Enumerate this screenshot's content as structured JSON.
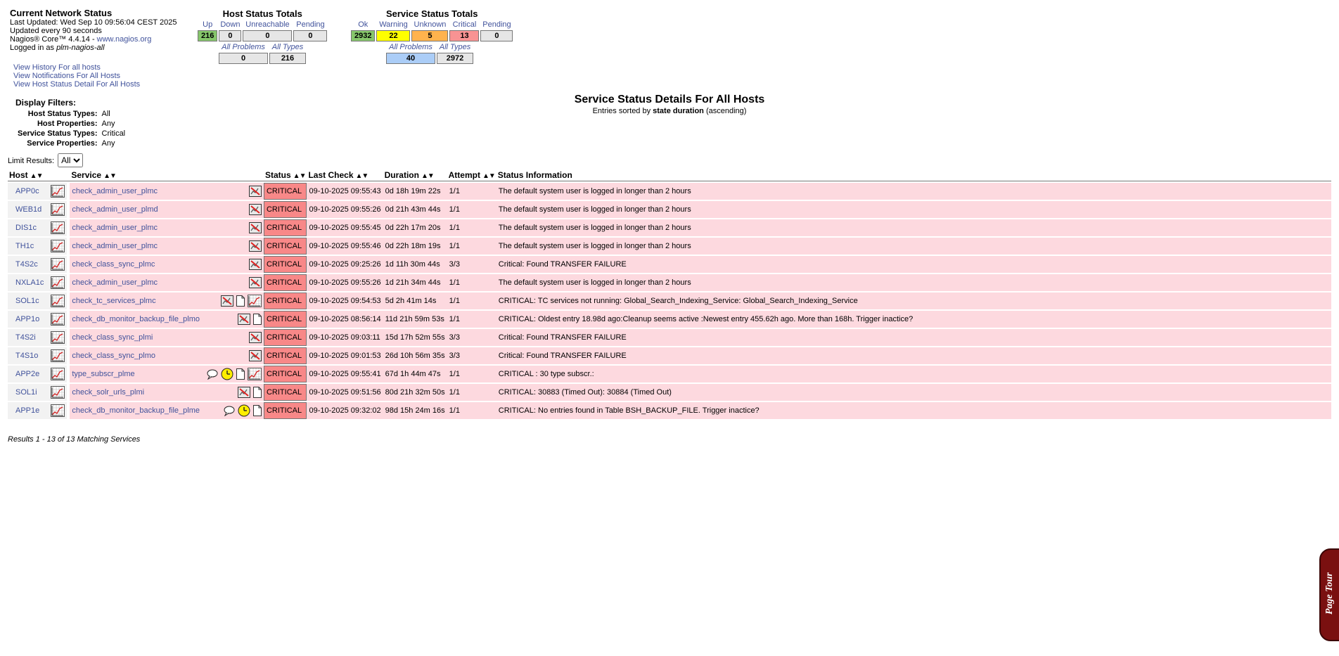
{
  "info": {
    "title": "Current Network Status",
    "last_updated": "Last Updated: Wed Sep 10 09:56:04 CEST 2025",
    "update_interval": "Updated every 90 seconds",
    "core_prefix": "Nagios® Core™ 4.4.14 - ",
    "core_link": "www.nagios.org",
    "logged_prefix": "Logged in as ",
    "logged_user": "plm-nagios-all"
  },
  "links": [
    "View History For all hosts",
    "View Notifications For All Hosts",
    "View Host Status Detail For All Hosts"
  ],
  "host_totals": {
    "title": "Host Status Totals",
    "headers": [
      "Up",
      "Down",
      "Unreachable",
      "Pending"
    ],
    "values": [
      "216",
      "0",
      "0",
      "0"
    ],
    "sub_headers": [
      "All Problems",
      "All Types"
    ],
    "sub_values": [
      "0",
      "216"
    ]
  },
  "service_totals": {
    "title": "Service Status Totals",
    "headers": [
      "Ok",
      "Warning",
      "Unknown",
      "Critical",
      "Pending"
    ],
    "values": [
      "2932",
      "22",
      "5",
      "13",
      "0"
    ],
    "sub_headers": [
      "All Problems",
      "All Types"
    ],
    "sub_values": [
      "40",
      "2972"
    ]
  },
  "page_title": {
    "title": "Service Status Details For All Hosts",
    "sort_prefix": "Entries sorted by ",
    "sort_field": "state duration",
    "sort_order": " (ascending)"
  },
  "filters": {
    "heading": "Display Filters:",
    "rows": [
      {
        "key": "Host Status Types:",
        "value": "All"
      },
      {
        "key": "Host Properties:",
        "value": "Any"
      },
      {
        "key": "Service Status Types:",
        "value": "Critical"
      },
      {
        "key": "Service Properties:",
        "value": "Any"
      }
    ]
  },
  "limit": {
    "label": "Limit Results:",
    "value": "All"
  },
  "table": {
    "headers": [
      "Host",
      "Service",
      "Status",
      "Last Check",
      "Duration",
      "Attempt",
      "Status Information"
    ],
    "rows": [
      {
        "host": "APP0c",
        "service": "check_admin_user_plmc",
        "icons": [
          "notif-disabled"
        ],
        "status": "CRITICAL",
        "last_check": "09-10-2025 09:55:43",
        "duration": "0d 18h 19m 22s",
        "attempt": "1/1",
        "info": "The default system user is logged in longer than 2 hours"
      },
      {
        "host": "WEB1d",
        "service": "check_admin_user_plmd",
        "icons": [
          "notif-disabled"
        ],
        "status": "CRITICAL",
        "last_check": "09-10-2025 09:55:26",
        "duration": "0d 21h 43m 44s",
        "attempt": "1/1",
        "info": "The default system user is logged in longer than 2 hours"
      },
      {
        "host": "DIS1c",
        "service": "check_admin_user_plmc",
        "icons": [
          "notif-disabled"
        ],
        "status": "CRITICAL",
        "last_check": "09-10-2025 09:55:45",
        "duration": "0d 22h 17m 20s",
        "attempt": "1/1",
        "info": "The default system user is logged in longer than 2 hours"
      },
      {
        "host": "TH1c",
        "service": "check_admin_user_plmc",
        "icons": [
          "notif-disabled"
        ],
        "status": "CRITICAL",
        "last_check": "09-10-2025 09:55:46",
        "duration": "0d 22h 18m 19s",
        "attempt": "1/1",
        "info": "The default system user is logged in longer than 2 hours"
      },
      {
        "host": "T4S2c",
        "service": "check_class_sync_plmc",
        "icons": [
          "notif-disabled"
        ],
        "status": "CRITICAL",
        "last_check": "09-10-2025 09:25:26",
        "duration": "1d 11h 30m 44s",
        "attempt": "3/3",
        "info": "Critical: Found TRANSFER FAILURE"
      },
      {
        "host": "NXLA1c",
        "service": "check_admin_user_plmc",
        "icons": [
          "notif-disabled"
        ],
        "status": "CRITICAL",
        "last_check": "09-10-2025 09:55:26",
        "duration": "1d 21h 34m 44s",
        "attempt": "1/1",
        "info": "The default system user is logged in longer than 2 hours"
      },
      {
        "host": "SOL1c",
        "service": "check_tc_services_plmc",
        "icons": [
          "notif-disabled",
          "doc",
          "graph"
        ],
        "status": "CRITICAL",
        "last_check": "09-10-2025 09:54:53",
        "duration": "5d 2h 41m 14s",
        "attempt": "1/1",
        "info": "CRITICAL: TC services not running: Global_Search_Indexing_Service: Global_Search_Indexing_Service"
      },
      {
        "host": "APP1o",
        "service": "check_db_monitor_backup_file_plmo",
        "icons": [
          "notif-disabled",
          "doc"
        ],
        "status": "CRITICAL",
        "last_check": "09-10-2025 08:56:14",
        "duration": "11d 21h 59m 53s",
        "attempt": "1/1",
        "info": "CRITICAL: Oldest entry 18.98d ago:Cleanup seems active :Newest entry 455.62h ago. More than 168h. Trigger inactice?"
      },
      {
        "host": "T4S2i",
        "service": "check_class_sync_plmi",
        "icons": [
          "notif-disabled"
        ],
        "status": "CRITICAL",
        "last_check": "09-10-2025 09:03:11",
        "duration": "15d 17h 52m 55s",
        "attempt": "3/3",
        "info": "Critical: Found TRANSFER FAILURE"
      },
      {
        "host": "T4S1o",
        "service": "check_class_sync_plmo",
        "icons": [
          "notif-disabled"
        ],
        "status": "CRITICAL",
        "last_check": "09-10-2025 09:01:53",
        "duration": "26d 10h 56m 35s",
        "attempt": "3/3",
        "info": "Critical: Found TRANSFER FAILURE"
      },
      {
        "host": "APP2e",
        "service": "type_subscr_plme",
        "icons": [
          "comment",
          "downtime",
          "doc",
          "graph"
        ],
        "status": "CRITICAL",
        "last_check": "09-10-2025 09:55:41",
        "duration": "67d 1h 44m 47s",
        "attempt": "1/1",
        "info": "CRITICAL : 30 type subscr.:"
      },
      {
        "host": "SOL1i",
        "service": "check_solr_urls_plmi",
        "icons": [
          "notif-disabled",
          "doc"
        ],
        "status": "CRITICAL",
        "last_check": "09-10-2025 09:51:56",
        "duration": "80d 21h 32m 50s",
        "attempt": "1/1",
        "info": "CRITICAL: 30883 (Timed Out): 30884 (Timed Out)"
      },
      {
        "host": "APP1e",
        "service": "check_db_monitor_backup_file_plme",
        "icons": [
          "comment",
          "downtime",
          "doc"
        ],
        "status": "CRITICAL",
        "last_check": "09-10-2025 09:32:02",
        "duration": "98d 15h 24m 16s",
        "attempt": "1/1",
        "info": "CRITICAL: No entries found in Table BSH_BACKUP_FILE. Trigger inactice?"
      }
    ]
  },
  "results": "Results 1 - 13 of 13 Matching Services",
  "page_tour": "Page Tour",
  "colors": {
    "link": "#40529b",
    "critical": "#f88888",
    "row_critical": "#fdd9df",
    "ok": "#86c66b",
    "warning": "#ffff00",
    "unknown": "#ffb34d"
  }
}
